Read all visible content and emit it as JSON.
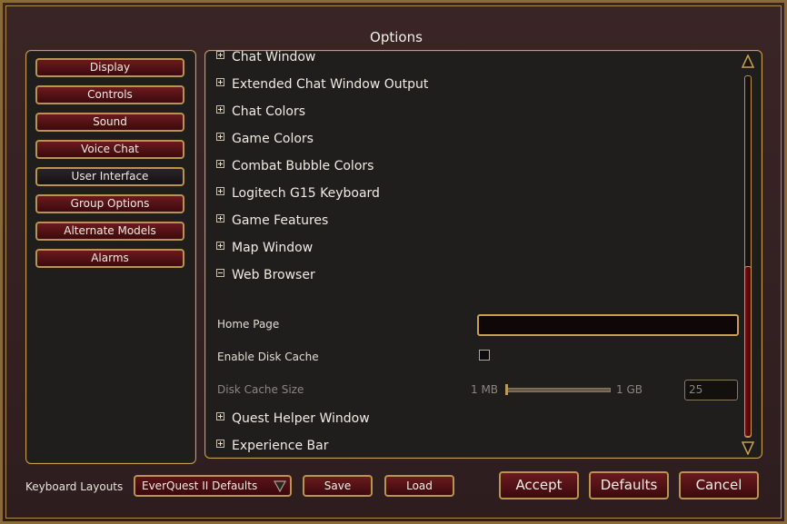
{
  "window": {
    "title": "Options"
  },
  "nav": {
    "items": [
      {
        "label": "Display"
      },
      {
        "label": "Controls"
      },
      {
        "label": "Sound"
      },
      {
        "label": "Voice Chat"
      },
      {
        "label": "User Interface"
      },
      {
        "label": "Group Options"
      },
      {
        "label": "Alternate Models"
      },
      {
        "label": "Alarms"
      }
    ],
    "active": "User Interface"
  },
  "sections": {
    "top": [
      {
        "label": "Chat Window",
        "expanded": false
      },
      {
        "label": "Extended Chat Window Output",
        "expanded": false
      },
      {
        "label": "Chat Colors",
        "expanded": false
      },
      {
        "label": "Game Colors",
        "expanded": false
      },
      {
        "label": "Combat Bubble Colors",
        "expanded": false
      },
      {
        "label": "Logitech G15 Keyboard",
        "expanded": false
      },
      {
        "label": "Game Features",
        "expanded": false
      },
      {
        "label": "Map Window",
        "expanded": false
      },
      {
        "label": "Web Browser",
        "expanded": true
      }
    ],
    "bottom": [
      {
        "label": "Quest Helper Window",
        "expanded": false
      },
      {
        "label": "Experience Bar",
        "expanded": false
      }
    ]
  },
  "web_browser": {
    "home_page": {
      "label": "Home Page",
      "value": ""
    },
    "enable_disk_cache": {
      "label": "Enable Disk Cache",
      "checked": false
    },
    "disk_cache_size": {
      "label": "Disk Cache Size",
      "min_label": "1 MB",
      "max_label": "1 GB",
      "value": "25",
      "level": 0.0,
      "enabled": false
    }
  },
  "scrollbar": {
    "icon_up": "scroll-up-arrow-icon",
    "icon_down": "scroll-down-arrow-icon"
  },
  "footer": {
    "keyboard_layouts_label": "Keyboard Layouts",
    "layout_selected": "EverQuest II Defaults",
    "save_label": "Save",
    "load_label": "Load",
    "accept_label": "Accept",
    "defaults_label": "Defaults",
    "cancel_label": "Cancel"
  },
  "colors": {
    "accent_gold": "#c8a050",
    "button_red": "#6a1a1e",
    "panel_bg": "#201d1d"
  }
}
